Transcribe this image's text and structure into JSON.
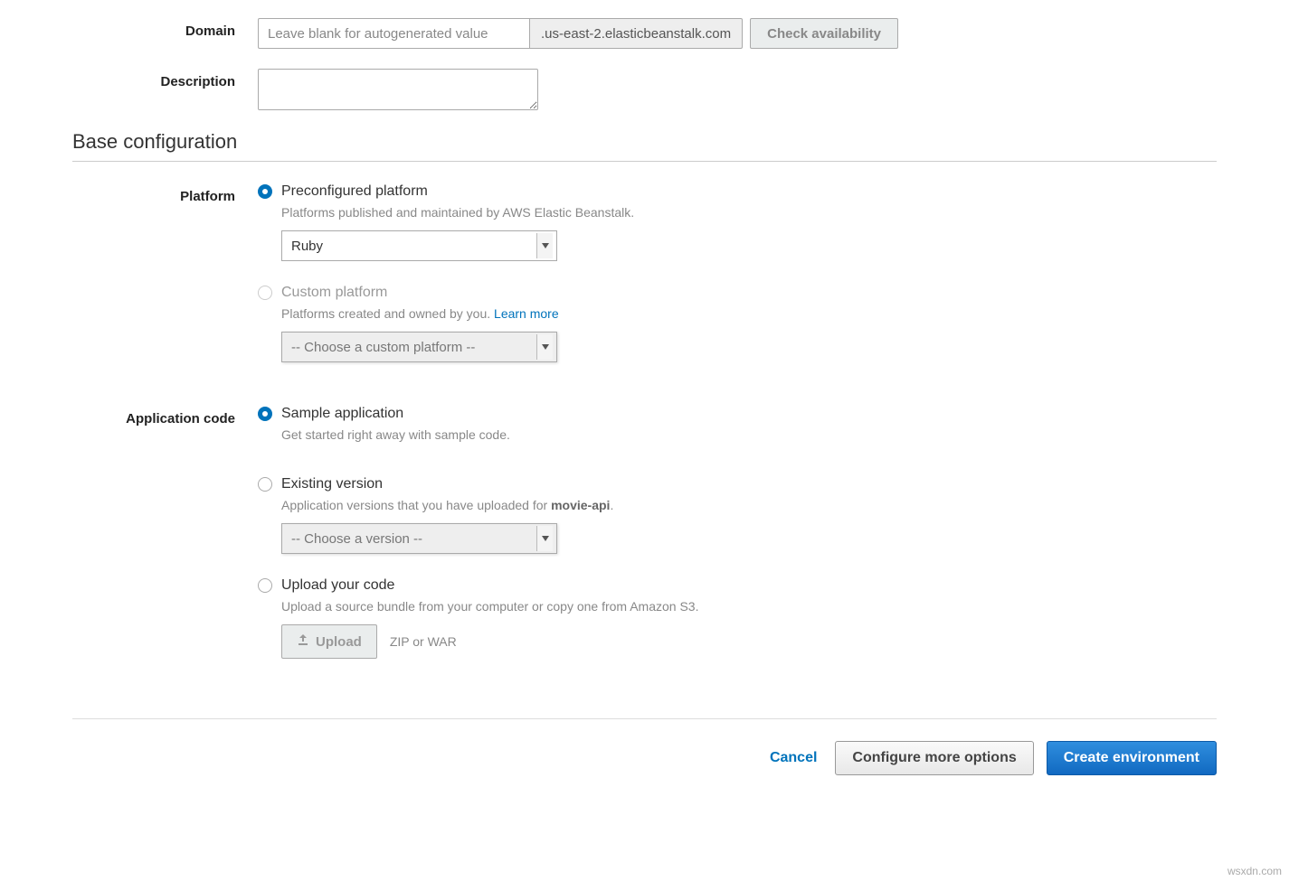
{
  "domain": {
    "label": "Domain",
    "placeholder": "Leave blank for autogenerated value",
    "suffix": ".us-east-2.elasticbeanstalk.com",
    "check_button": "Check availability"
  },
  "description": {
    "label": "Description"
  },
  "base_config": {
    "title": "Base configuration"
  },
  "platform": {
    "label": "Platform",
    "preconfigured": {
      "label": "Preconfigured platform",
      "desc": "Platforms published and maintained by AWS Elastic Beanstalk.",
      "selected": "Ruby"
    },
    "custom": {
      "label": "Custom platform",
      "desc": "Platforms created and owned by you. ",
      "learn_more": "Learn more",
      "placeholder": "-- Choose a custom platform --"
    }
  },
  "appcode": {
    "label": "Application code",
    "sample": {
      "label": "Sample application",
      "desc": "Get started right away with sample code."
    },
    "existing": {
      "label": "Existing version",
      "desc_prefix": "Application versions that you have uploaded for ",
      "app_name": "movie-api",
      "desc_suffix": ".",
      "placeholder": "-- Choose a version --"
    },
    "upload": {
      "label": "Upload your code",
      "desc": "Upload a source bundle from your computer or copy one from Amazon S3.",
      "button": "Upload",
      "hint": "ZIP or WAR"
    }
  },
  "footer": {
    "cancel": "Cancel",
    "configure": "Configure more options",
    "create": "Create environment"
  },
  "watermark": "wsxdn.com"
}
